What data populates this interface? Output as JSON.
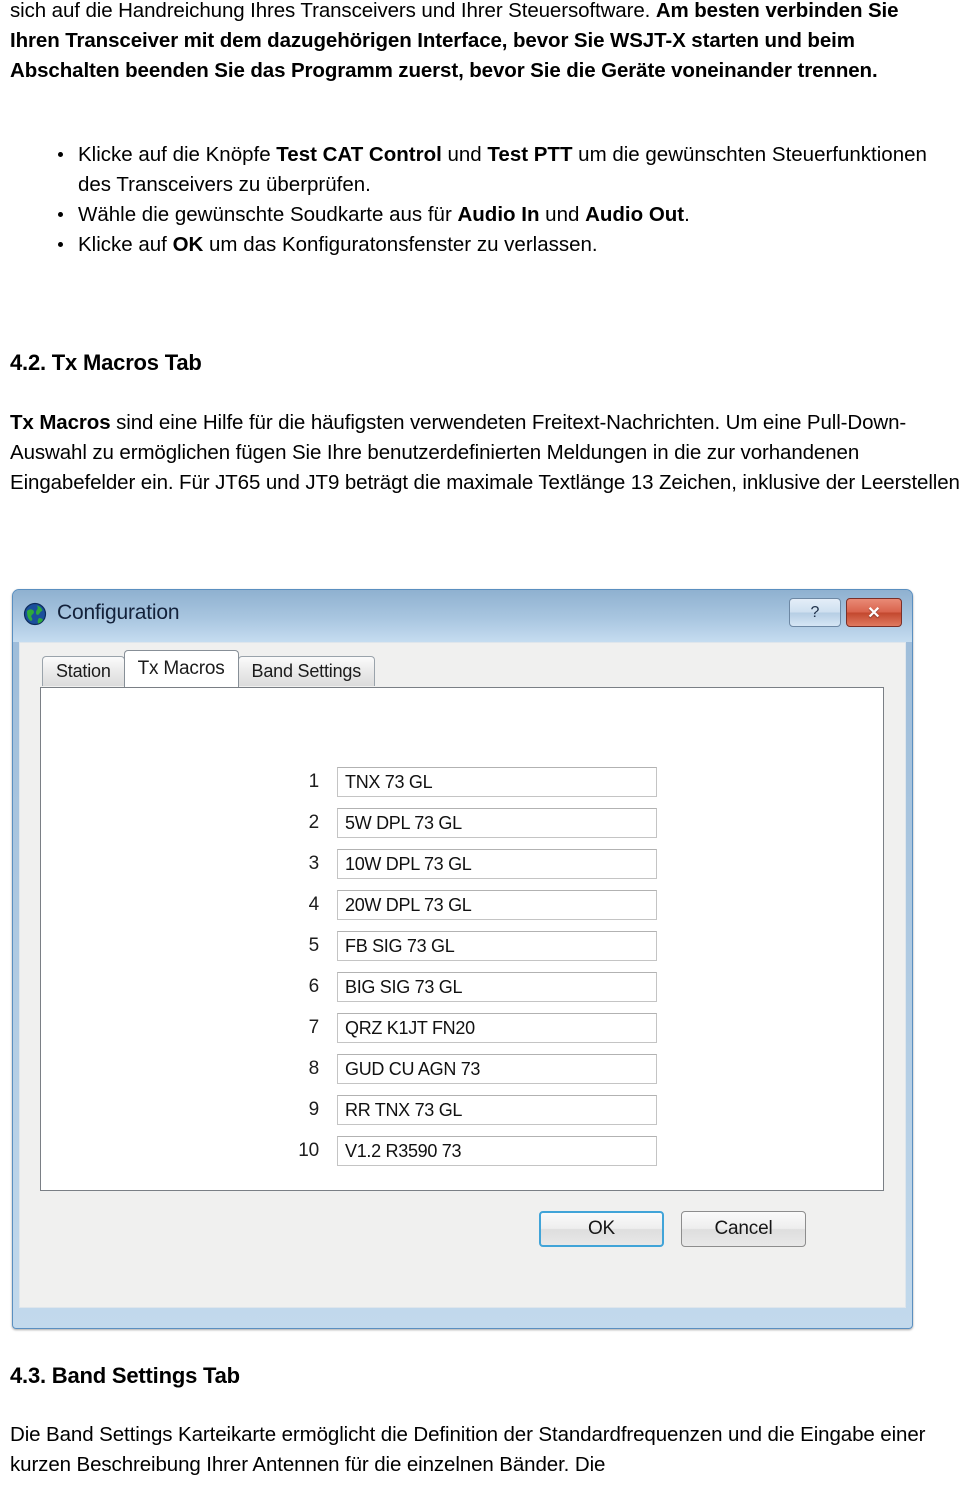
{
  "document": {
    "intro_paragraph_html": "sich auf die Handreichung Ihres Transceivers und Ihrer Steuersoftware. <b>Am besten verbinden Sie Ihren Transceiver mit dem dazugehörigen Interface, bevor Sie WSJT-X starten und beim Abschalten beenden Sie das Programm zuerst, bevor Sie die Geräte voneinander trennen.</b>",
    "bullets": [
      "Klicke auf die Knöpfe <b>Test CAT Control</b> und <b>Test PTT</b> um die gewünschten Steuerfunktionen des Transceivers zu überprüfen.",
      "Wähle die gewünschte Soudkarte aus für <b>Audio In</b> und <b>Audio Out</b>.",
      "Klicke auf <b>OK</b> um das Konfiguratonsfenster zu verlassen."
    ],
    "section_42_heading": "4.2. Tx Macros Tab",
    "section_42_body_html": "<b>Tx Macros</b> sind eine Hilfe für die häufigsten verwendeten Freitext-Nachrichten. Um eine Pull-Down-Auswahl zu ermöglichen fügen Sie Ihre benutzerdefinierten Meldungen in die zur vorhandenen Eingabefelder ein. Für JT65 und JT9 beträgt die maximale Textlänge 13 Zeichen, inklusive der Leerstellen.",
    "section_43_heading": "4.3. Band Settings Tab",
    "section_43_body_html": "Die Band Settings Karteikarte ermöglicht die Definition der Standardfrequenzen und die Eingabe einer kurzen Beschreibung Ihrer Antennen für die einzelnen Bänder. Die"
  },
  "dialog": {
    "title": "Configuration",
    "title_icon": "globe-icon",
    "window_buttons": {
      "help_label": "?",
      "close_label": "✕"
    },
    "tabs": [
      {
        "label": "Station",
        "active": false
      },
      {
        "label": "Tx Macros",
        "active": true
      },
      {
        "label": "Band Settings",
        "active": false
      }
    ],
    "macros": [
      {
        "index": "1",
        "value": "TNX 73 GL"
      },
      {
        "index": "2",
        "value": "5W DPL 73 GL"
      },
      {
        "index": "3",
        "value": "10W DPL 73 GL"
      },
      {
        "index": "4",
        "value": "20W DPL 73 GL"
      },
      {
        "index": "5",
        "value": "FB SIG 73 GL"
      },
      {
        "index": "6",
        "value": "BIG SIG 73 GL"
      },
      {
        "index": "7",
        "value": "QRZ K1JT FN20"
      },
      {
        "index": "8",
        "value": "GUD CU AGN 73"
      },
      {
        "index": "9",
        "value": "RR TNX 73 GL"
      },
      {
        "index": "10",
        "value": "V1.2 R3590 73"
      }
    ],
    "buttons": {
      "ok_label": "OK",
      "cancel_label": "Cancel"
    },
    "colors": {
      "titlebar_top": "#8fb1d0",
      "titlebar_bottom": "#c5dcf0",
      "close_button": "#d9644d",
      "default_button_focus_ring": "#41a4d8",
      "panel_background": "#ffffff",
      "dialog_background": "#f0f0ef"
    }
  }
}
